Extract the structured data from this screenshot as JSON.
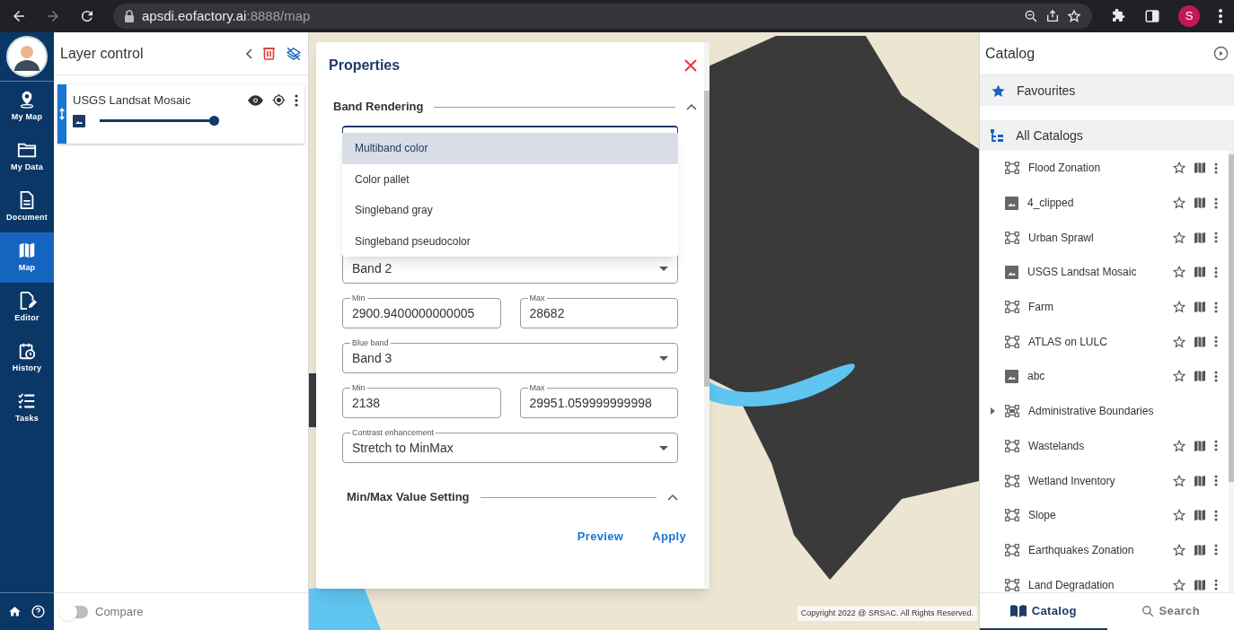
{
  "browser": {
    "url_host": "apsdi.eofactory.ai",
    "url_rest": ":8888/map",
    "profile": "S"
  },
  "nav": [
    {
      "label": "My Map",
      "kind": "pin",
      "selected": false
    },
    {
      "label": "My Data",
      "kind": "folder",
      "selected": false
    },
    {
      "label": "Document",
      "kind": "doc",
      "selected": false
    },
    {
      "label": "Map",
      "kind": "map",
      "selected": true
    },
    {
      "label": "Editor",
      "kind": "edit",
      "selected": false
    },
    {
      "label": "History",
      "kind": "history",
      "selected": false
    },
    {
      "label": "Tasks",
      "kind": "tasks",
      "selected": false
    }
  ],
  "layer_panel": {
    "title": "Layer control",
    "layers": [
      {
        "name": "USGS Landsat Mosaic",
        "level": 1
      }
    ],
    "compare": {
      "label": "Compare",
      "on": false
    }
  },
  "properties": {
    "title": "Properties",
    "section": "Band Rendering",
    "render_type_menu": [
      {
        "label": "Multiband color",
        "selected": true
      },
      {
        "label": "Color pallet",
        "selected": false
      },
      {
        "label": "Singleband gray",
        "selected": false
      },
      {
        "label": "Singleband pseudocolor",
        "selected": false
      }
    ],
    "fields": [
      {
        "kind": "select",
        "value": "Band 2"
      },
      {
        "kind": "pair",
        "items": [
          {
            "label": "Min",
            "value": "2900.9400000000005"
          },
          {
            "label": "Max",
            "value": "28682"
          }
        ]
      },
      {
        "kind": "select",
        "label": "Blue band",
        "value": "Band 3"
      },
      {
        "kind": "pair",
        "items": [
          {
            "label": "Min",
            "value": "2138"
          },
          {
            "label": "Max",
            "value": "29951.059999999998"
          }
        ]
      },
      {
        "kind": "select",
        "label": "Contrast enhancement",
        "value": "Stretch to MinMax"
      }
    ],
    "subsection": "Min/Max Value Setting",
    "buttons": [
      "Preview",
      "Apply"
    ]
  },
  "map": {
    "copyright": "Copyright 2022 @ SRSAC. All Rights Reserved."
  },
  "catalog": {
    "title": "Catalog",
    "favourites": "Favourites",
    "all": "All Catalogs",
    "items": [
      {
        "kind": "vector",
        "name": "Flood Zonation"
      },
      {
        "kind": "raster",
        "name": "4_clipped"
      },
      {
        "kind": "vector",
        "name": "Urban Sprawl"
      },
      {
        "kind": "raster",
        "name": "USGS Landsat Mosaic"
      },
      {
        "kind": "vector",
        "name": "Farm"
      },
      {
        "kind": "vector",
        "name": "ATLAS on LULC"
      },
      {
        "kind": "raster",
        "name": "abc"
      },
      {
        "kind": "group",
        "name": "Administrative Boundaries",
        "expanded": false
      },
      {
        "kind": "vector",
        "name": "Wastelands"
      },
      {
        "kind": "vector",
        "name": "Wetland Inventory"
      },
      {
        "kind": "vector",
        "name": "Slope"
      },
      {
        "kind": "vector",
        "name": "Earthquakes Zonation"
      },
      {
        "kind": "vector",
        "name": "Land Degradation"
      }
    ],
    "tabs": [
      {
        "label": "Catalog",
        "kind": "book",
        "selected": true
      },
      {
        "label": "Search",
        "kind": "search",
        "selected": false
      }
    ]
  }
}
